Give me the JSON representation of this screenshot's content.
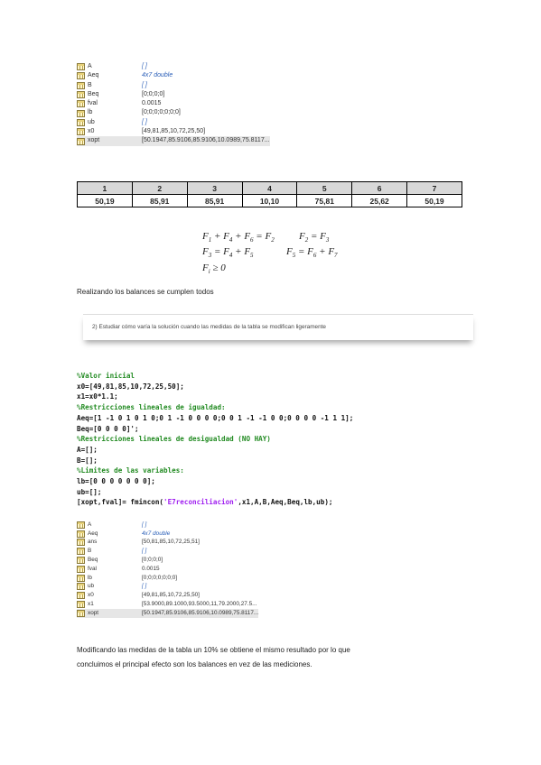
{
  "workspace1": [
    {
      "name": "A",
      "value": "[ ]",
      "style": "blue"
    },
    {
      "name": "Aeq",
      "value": "4x7 double",
      "style": "blue"
    },
    {
      "name": "B",
      "value": "[ ]",
      "style": "blue"
    },
    {
      "name": "Beq",
      "value": "[0;0;0;0]",
      "style": "plain"
    },
    {
      "name": "fval",
      "value": "0.0015",
      "style": "plain"
    },
    {
      "name": "lb",
      "value": "[0;0;0;0;0;0;0]",
      "style": "plain"
    },
    {
      "name": "ub",
      "value": "[ ]",
      "style": "blue"
    },
    {
      "name": "x0",
      "value": "[49,81,85,10,72,25,50]",
      "style": "plain"
    },
    {
      "name": "xopt",
      "value": "[50.1947,85.9106,85.9106,10.0989,75.8117...",
      "style": "plain"
    }
  ],
  "table": {
    "headers": [
      "1",
      "2",
      "3",
      "4",
      "5",
      "6",
      "7"
    ],
    "values": [
      "50,19",
      "85,91",
      "85,91",
      "10,10",
      "75,81",
      "25,62",
      "50,19"
    ]
  },
  "equations": {
    "row1_left": "F₁ + F₄ + F₆ = F₂",
    "row1_right": "F₂ = F₃",
    "row2_left": "F₃ = F₄ + F₅",
    "row2_right": "F₅ = F₆ + F₇",
    "row3": "Fᵢ ≥ 0"
  },
  "text_balances": "Realizando los balances se cumplen todos",
  "question": "2) Estudiar cómo varía la solución cuando las medidas de la tabla se modifican ligeramente",
  "code": {
    "c1": "%Valor inicial",
    "l1": "x0=[49,81,85,10,72,25,50];",
    "l2": "x1=x0*1.1;",
    "c2": "%Restricciones lineales de igualdad:",
    "l3": "Aeq=[1 -1 0 1 0 1 0;0 1 -1 0 0 0 0;0 0 1 -1 -1 0 0;0 0 0 0 -1 1 1];",
    "l4": "Beq=[0 0 0 0]';",
    "c3": "%Restricciones lineales de desigualdad (NO HAY)",
    "l5": "A=[];",
    "l6": "B=[];",
    "c4": "%Limites de las variables:",
    "l7": "lb=[0 0 0 0 0 0 0];",
    "l8": "ub=[];",
    "l9a": "[xopt,fval]= fmincon(",
    "l9s": "'E7reconciliacion'",
    "l9b": ",x1,A,B,Aeq,Beq,lb,ub);"
  },
  "workspace2": [
    {
      "name": "A",
      "value": "[ ]",
      "style": "blue"
    },
    {
      "name": "Aeq",
      "value": "4x7 double",
      "style": "blue"
    },
    {
      "name": "ans",
      "value": "[50,81,85,10,72,25,51]",
      "style": "plain"
    },
    {
      "name": "B",
      "value": "[ ]",
      "style": "blue"
    },
    {
      "name": "Beq",
      "value": "[0;0;0;0]",
      "style": "plain"
    },
    {
      "name": "fval",
      "value": "0.0015",
      "style": "plain"
    },
    {
      "name": "lb",
      "value": "[0;0;0;0;0;0;0]",
      "style": "plain"
    },
    {
      "name": "ub",
      "value": "[ ]",
      "style": "blue"
    },
    {
      "name": "x0",
      "value": "[49,81,85,10,72,25,50]",
      "style": "plain"
    },
    {
      "name": "x1",
      "value": "[53.9000,89.1000,93.5000,11,79.2000,27.5...",
      "style": "plain"
    },
    {
      "name": "xopt",
      "value": "[50.1947,85.9106,85.9106,10.0989,75.8117...",
      "style": "plain"
    }
  ],
  "conclusion_line1": "Modificando las medidas de la tabla un 10% se obtiene el mismo resultado por lo que",
  "conclusion_line2": "concluimos el principal efecto son los balances en vez de las mediciones."
}
